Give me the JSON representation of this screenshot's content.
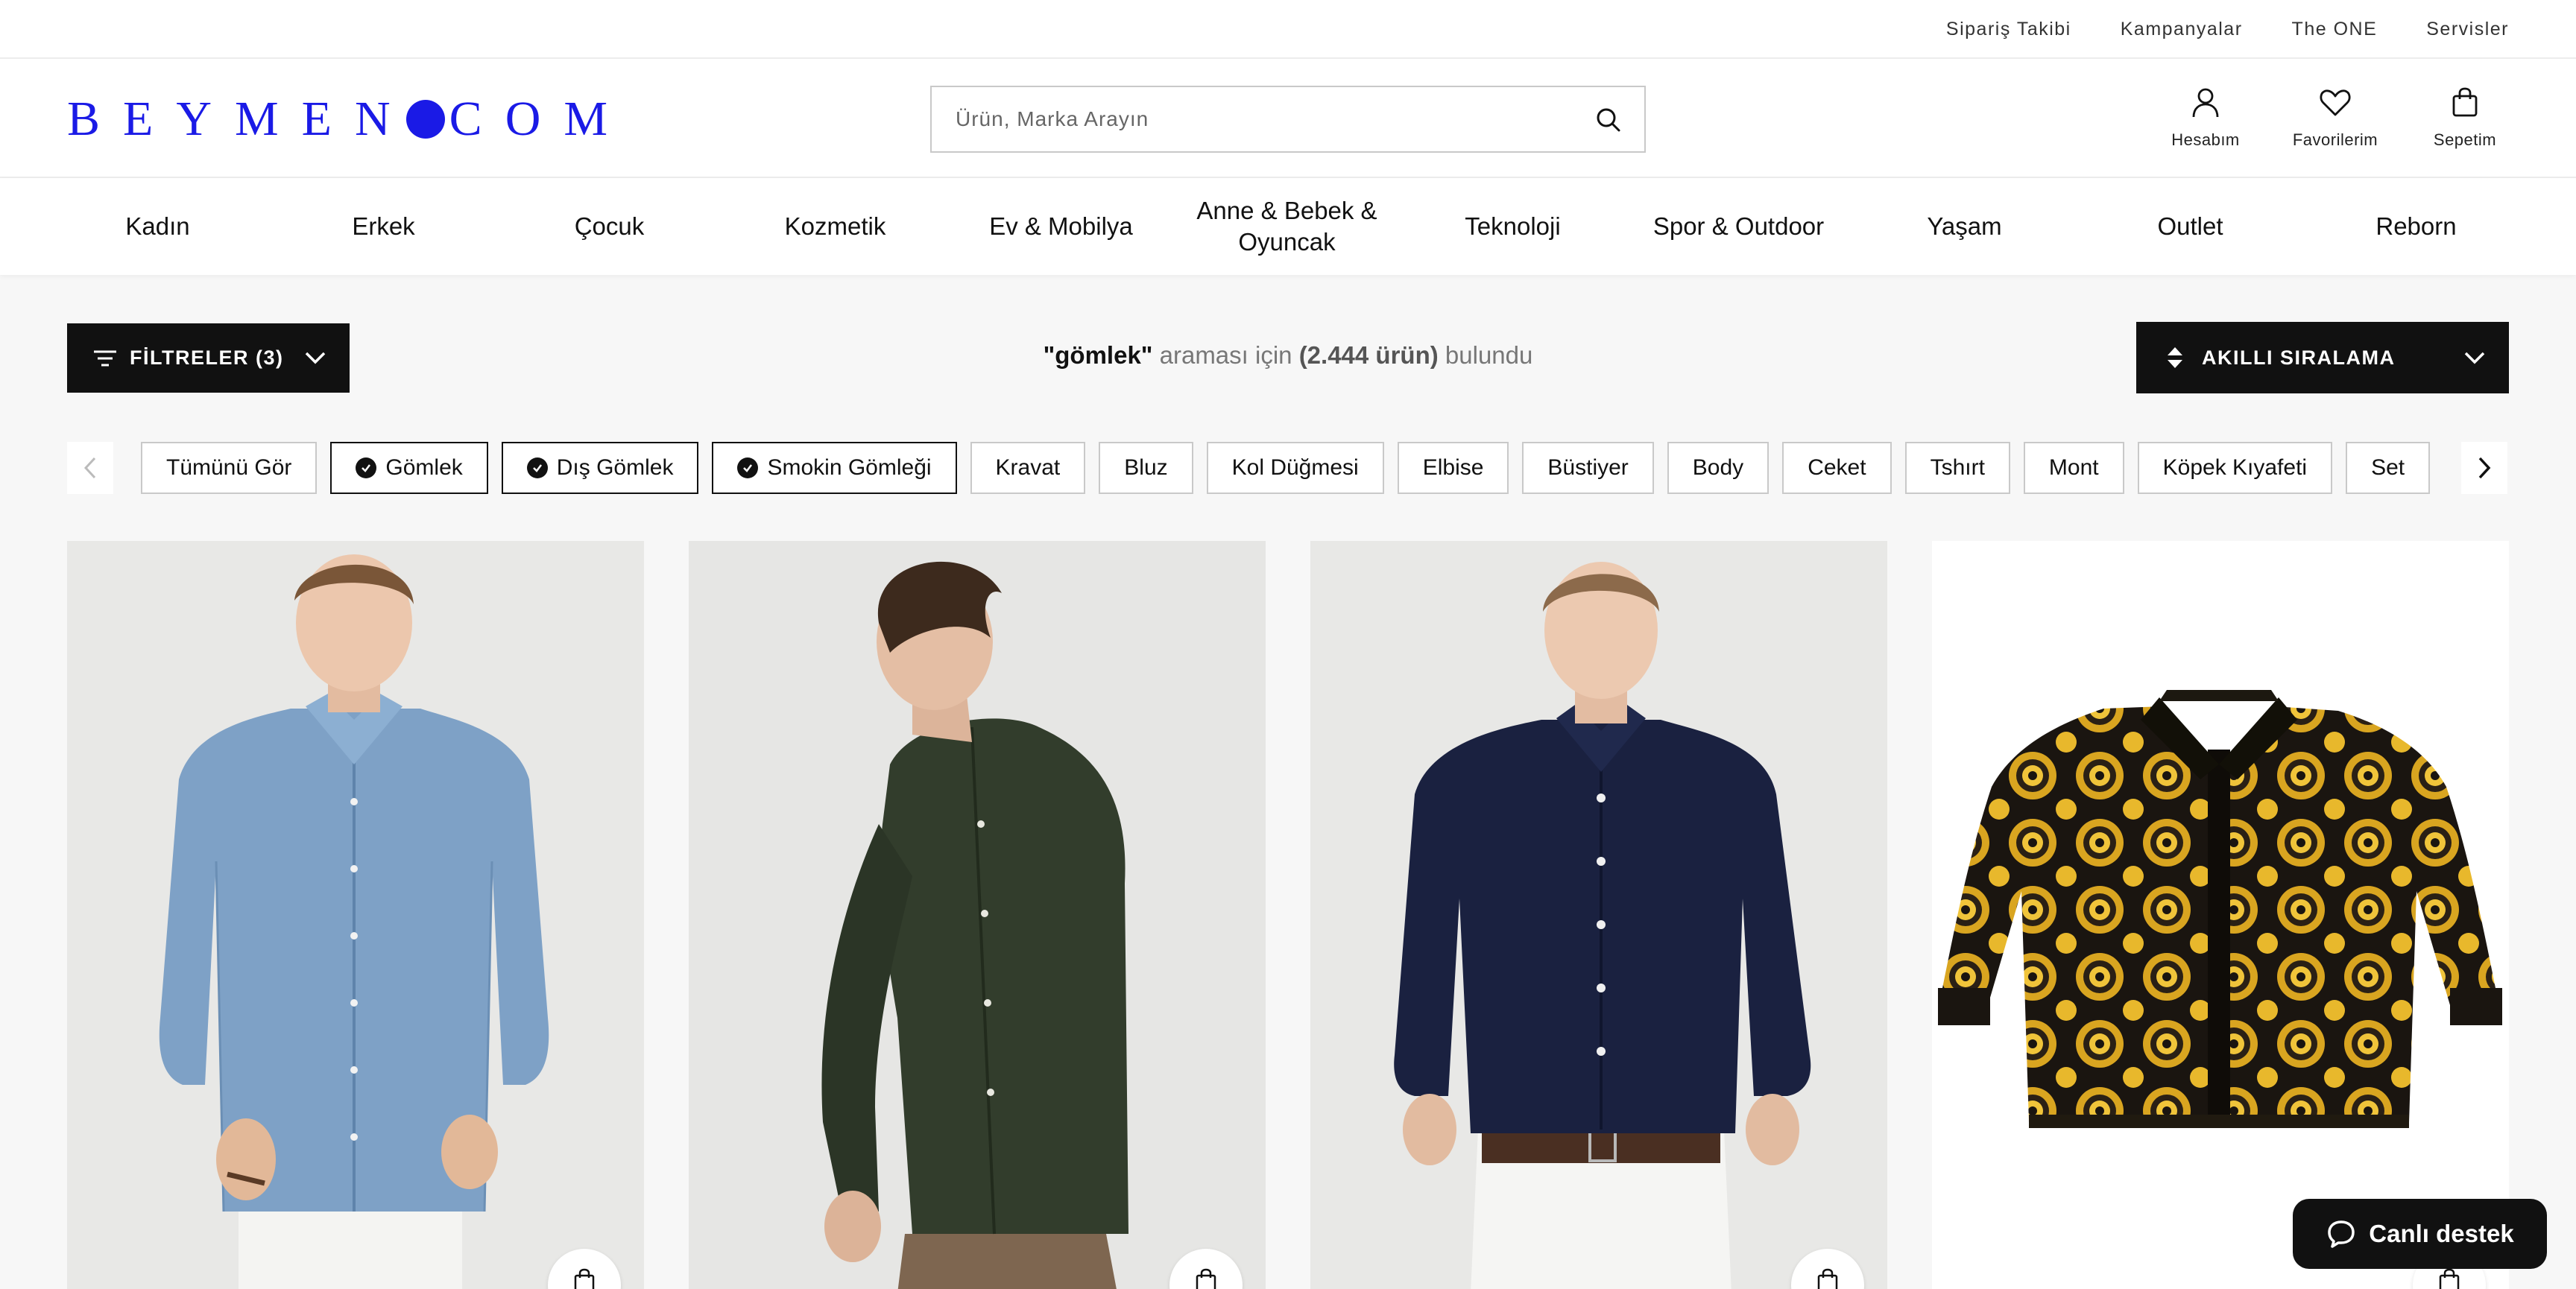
{
  "topbar": {
    "links": [
      "Sipariş Takibi",
      "Kampanyalar",
      "The ONE",
      "Servisler"
    ]
  },
  "header": {
    "logo_left": "BEYMEN",
    "logo_right": "COM",
    "search_placeholder": "Ürün, Marka Arayın",
    "account_label": "Hesabım",
    "favorites_label": "Favorilerim",
    "cart_label": "Sepetim"
  },
  "nav": {
    "items": [
      "Kadın",
      "Erkek",
      "Çocuk",
      "Kozmetik",
      "Ev & Mobilya",
      "Anne & Bebek & Oyuncak",
      "Teknoloji",
      "Spor & Outdoor",
      "Yaşam",
      "Outlet",
      "Reborn"
    ]
  },
  "toolbar": {
    "filters_label": "FİLTRELER (3)",
    "query": "\"gömlek\"",
    "mid_text": " araması için ",
    "count": "(2.444 ürün)",
    "end_text": " bulundu",
    "sort_label": "AKILLI SIRALAMA"
  },
  "chips": {
    "items": [
      "Tümünü Gör",
      "Gömlek",
      "Dış Gömlek",
      "Smokin Gömleği",
      "Kravat",
      "Bluz",
      "Kol Düğmesi",
      "Elbise",
      "Büstiyer",
      "Body",
      "Ceket",
      "Tshırt",
      "Mont",
      "Köpek Kıyafeti",
      "Set"
    ],
    "selected": [
      "Gömlek",
      "Dış Gömlek",
      "Smokin Gömleği"
    ]
  },
  "products": [
    {
      "image": "light-blue-denim-shirt"
    },
    {
      "image": "dark-green-shirt-side-view"
    },
    {
      "image": "navy-shirt-white-pants"
    },
    {
      "image": "gold-baroque-print-shirt"
    }
  ],
  "chat": {
    "label": "Canlı destek"
  },
  "colors": {
    "brand_blue": "#1a1ae6",
    "dark": "#111111",
    "background": "#f7f7f7"
  }
}
